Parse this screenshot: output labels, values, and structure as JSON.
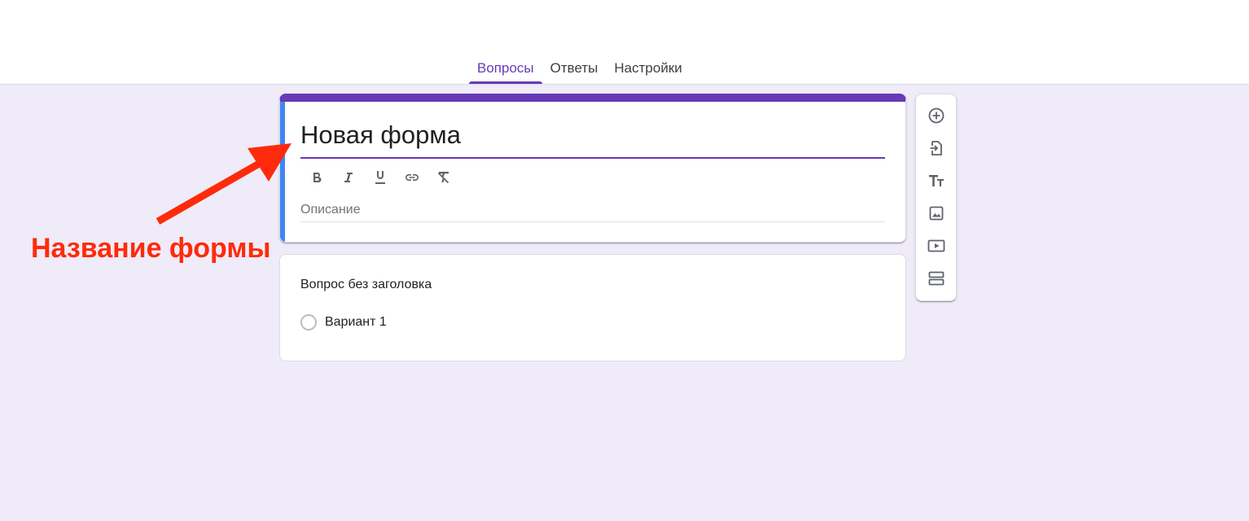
{
  "tabs": [
    {
      "label": "Вопросы",
      "active": true
    },
    {
      "label": "Ответы",
      "active": false
    },
    {
      "label": "Настройки",
      "active": false
    }
  ],
  "form": {
    "title": "Новая форма",
    "description_placeholder": "Описание",
    "formatting_toolbar": [
      "bold-icon",
      "italic-icon",
      "underline-icon",
      "link-icon",
      "clear-format-icon"
    ]
  },
  "question": {
    "title": "Вопрос без заголовка",
    "options": [
      "Вариант 1"
    ]
  },
  "side_toolbar": [
    "add-question-icon",
    "import-questions-icon",
    "add-title-icon",
    "add-image-icon",
    "add-video-icon",
    "add-section-icon"
  ],
  "annotation": {
    "label": "Название формы"
  },
  "colors": {
    "accent": "#673ab7",
    "focus_bar": "#4285f4",
    "background": "#f0ebf8",
    "annotation": "#ff2a0b"
  }
}
